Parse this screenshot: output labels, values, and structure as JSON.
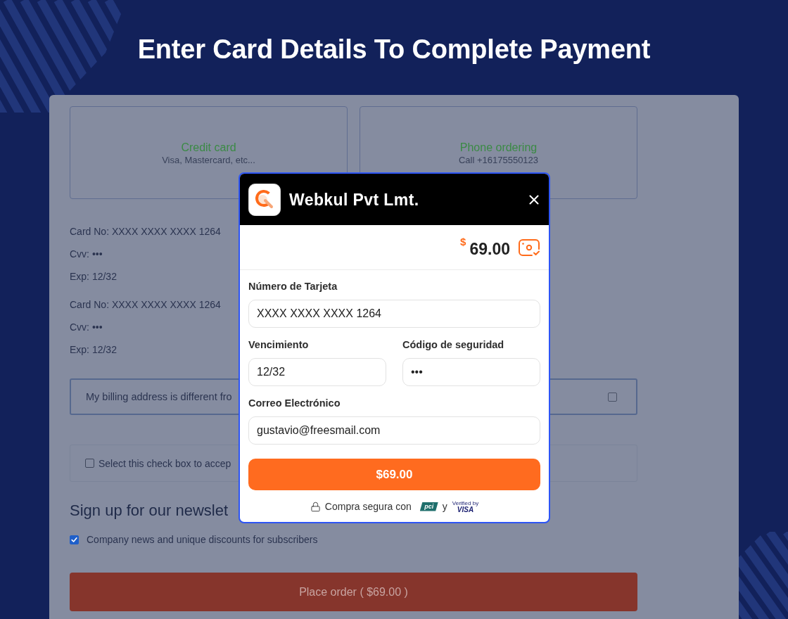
{
  "page": {
    "title": "Enter Card Details To Complete Payment"
  },
  "payment_methods": [
    {
      "title": "Credit card",
      "subtitle": "Visa, Mastercard, etc..."
    },
    {
      "title": "Phone ordering",
      "subtitle": "Call +16175550123"
    }
  ],
  "saved_cards": [
    {
      "lines": [
        "Card No: XXXX XXXX XXXX 1264",
        "Cvv: •••",
        "Exp: 12/32"
      ]
    },
    {
      "lines": [
        "Card No: XXXX XXXX XXXX 1264",
        "Cvv: •••",
        "Exp: 12/32"
      ]
    }
  ],
  "billing_option": {
    "label": "My billing address is different fro",
    "checked": false
  },
  "terms_option": {
    "label": "Select this check box to accep",
    "checked": false
  },
  "newsletter": {
    "heading": "Sign up for our newslet",
    "option": {
      "label": "Company news and unique discounts for subscribers",
      "checked": true
    }
  },
  "place_order_button": "Place order ( $69.00 )",
  "payment_dialog": {
    "merchant": "Webkul Pvt Lmt.",
    "currency_symbol": "$",
    "amount": "69.00",
    "field_rows": [
      [
        {
          "label": "Número de Tarjeta",
          "value": "XXXX XXXX XXXX 1264"
        }
      ],
      [
        {
          "label": "Vencimiento",
          "value": "12/32"
        },
        {
          "label": "Código de seguridad",
          "value": "•••"
        }
      ],
      [
        {
          "label": "Correo Electrónico",
          "value": "gustavio@freesmail.com"
        }
      ]
    ],
    "pay_button": "$69.00",
    "secure_note": "Compra segura con",
    "pci_badge": "pci",
    "conjunction": "y",
    "visa_badge": {
      "caption": "Verified by",
      "brand": "VISA"
    }
  }
}
